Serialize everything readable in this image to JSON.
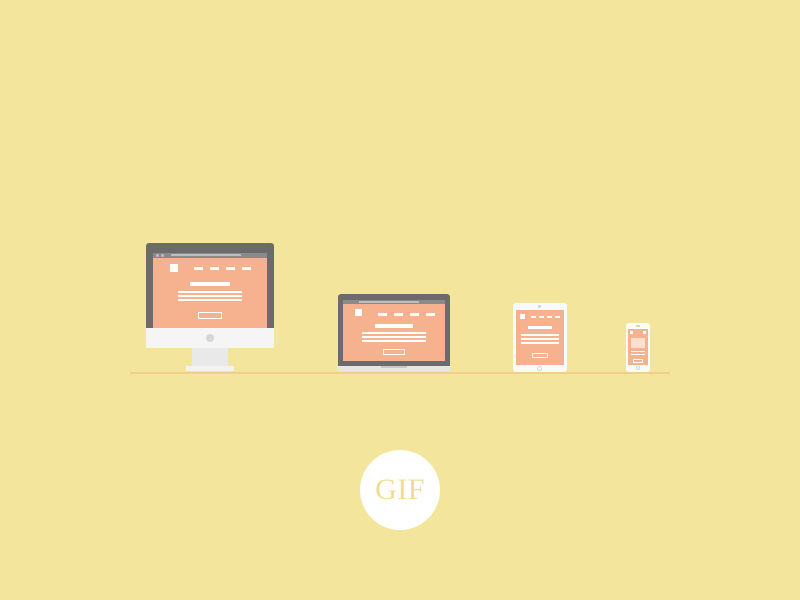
{
  "badge": {
    "label": "GIF"
  },
  "devices": [
    "desktop",
    "laptop",
    "tablet",
    "phone"
  ]
}
